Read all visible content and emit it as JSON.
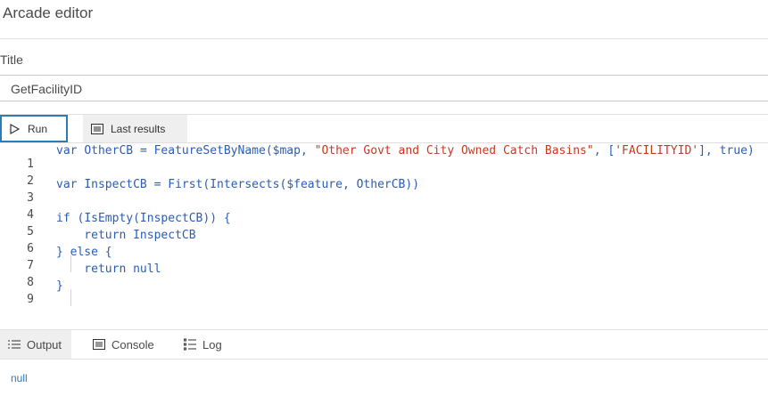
{
  "header": {
    "title": "Arcade editor"
  },
  "title_field": {
    "label": "Title",
    "value": "GetFacilityID"
  },
  "toolbar": {
    "run_label": "Run",
    "last_results_label": "Last results"
  },
  "editor": {
    "lines": [
      {
        "number": "1",
        "code": "var OtherCB = FeatureSetByName($map, \"Other Govt and City Owned Catch Basins\", ['FACILITYID'], true)"
      },
      {
        "number": "2",
        "code": ""
      },
      {
        "number": "3",
        "code": "var InspectCB = First(Intersects($feature, OtherCB))"
      },
      {
        "number": "4",
        "code": ""
      },
      {
        "number": "5",
        "code": "if (IsEmpty(InspectCB)) {"
      },
      {
        "number": "6",
        "code": "    return InspectCB"
      },
      {
        "number": "7",
        "code": "} else {"
      },
      {
        "number": "8",
        "code": "    return null"
      },
      {
        "number": "9",
        "code": "}"
      }
    ]
  },
  "bottom_tabs": {
    "output": "Output",
    "console": "Console",
    "log": "Log"
  },
  "output": {
    "value": "null"
  },
  "colors": {
    "accent": "#2b7bb9",
    "keyword": "#2b5db3",
    "string": "#c43a1f"
  }
}
